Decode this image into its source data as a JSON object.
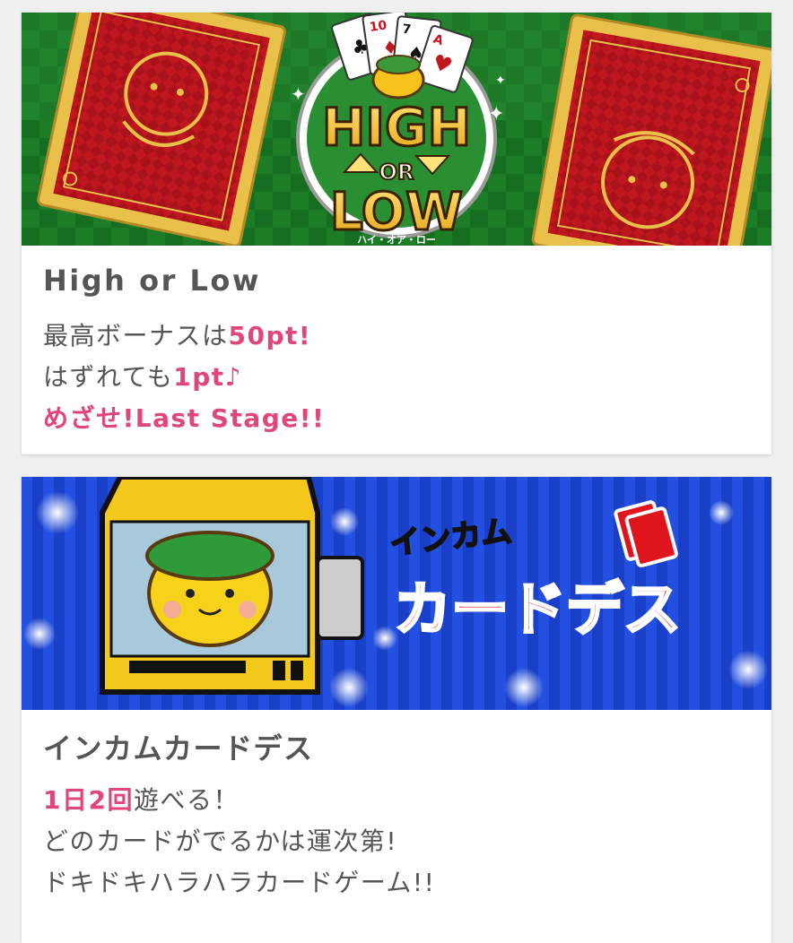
{
  "cards": [
    {
      "banner": {
        "logo_text": [
          "HIGH",
          "OR",
          "LOW"
        ],
        "logo_kana": "ハイ・オア・ロー",
        "card_ranks": [
          "10",
          "7",
          "A"
        ],
        "colors": {
          "green": "#1b7a24",
          "red": "#c0171f",
          "gold": "#e9c04a"
        }
      },
      "title": "High or Low",
      "lines": [
        {
          "text": "最高ボーナスは",
          "highlight": "50pt!"
        },
        {
          "text": "はずれても",
          "highlight": "1pt♪"
        },
        {
          "text": "",
          "highlight": "めざせ!Last Stage!!"
        }
      ]
    },
    {
      "banner": {
        "logo_small": "インカム",
        "logo_big": "カードデス",
        "colors": {
          "blue": "#1a3fc8",
          "red": "#e0141c",
          "yellow": "#f4c91c"
        }
      },
      "title": "インカムカードデス",
      "lines": [
        {
          "highlight": "1日2回",
          "text": "遊べる！"
        },
        {
          "highlight": "",
          "text": "どのカードがでるかは運次第!"
        },
        {
          "highlight": "",
          "text": "ドキドキハラハラカードゲーム!!"
        }
      ]
    }
  ],
  "accent_color": "#e0457b"
}
